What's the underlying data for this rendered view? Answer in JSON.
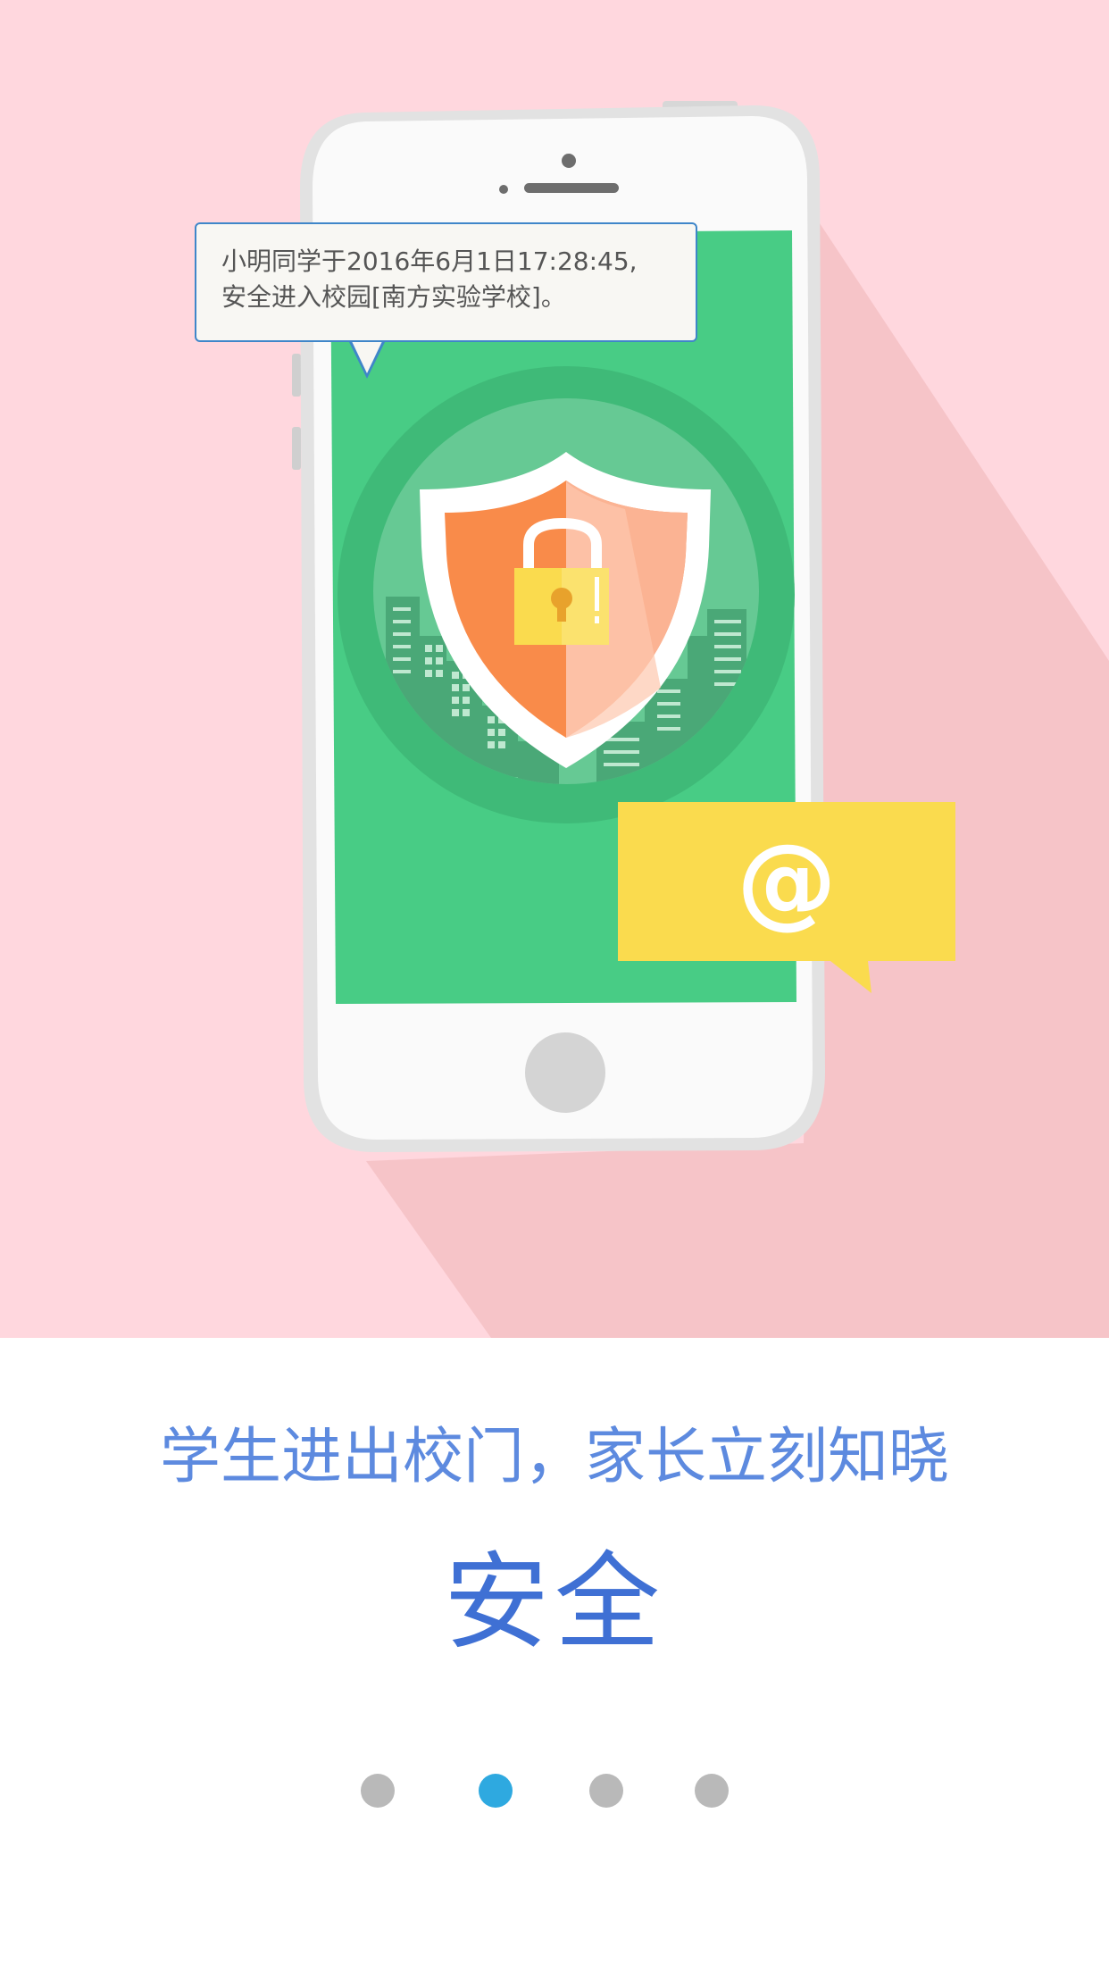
{
  "notification": {
    "line1": "小明同学于2016年6月1日17:28:45,",
    "line2": "安全进入校园[南方实验学校]。"
  },
  "at_message": {
    "symbol": "@",
    "icon": "email-at-icon"
  },
  "illustration": {
    "icon": "shield-lock-icon"
  },
  "tagline": "学生进出校门，家长立刻知晓",
  "title": "安全",
  "pagination": {
    "total": 4,
    "active_index": 1
  },
  "colors": {
    "hero_background": "#ffd7de",
    "phone_screen": "#48cc85",
    "shield": "#f98b4a",
    "lock": "#fadb4e",
    "tagline": "#5d8adf",
    "title": "#3f70d4",
    "active_dot": "#2ea9e0",
    "inactive_dot": "#b9b9b9"
  }
}
